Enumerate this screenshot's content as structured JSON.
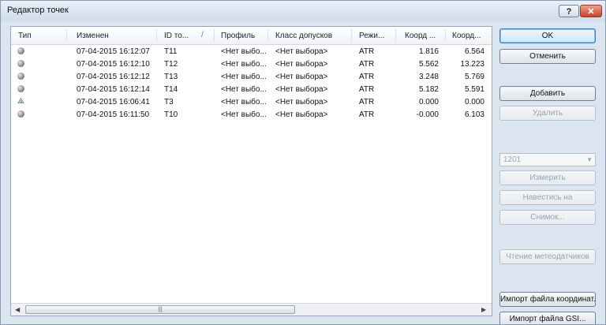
{
  "window": {
    "title": "Редактор точек",
    "help_label": "?",
    "close_label": "✕"
  },
  "columns": [
    "Тип",
    "Изменен",
    "ID то...",
    "Профиль",
    "Класс допусков",
    "Режи...",
    "Коорд ...",
    "Коорд..."
  ],
  "sort_indicator": "/",
  "rows": [
    {
      "type_icon": "gray-sphere-icon",
      "changed": "07-04-2015 16:12:07",
      "id": "T11",
      "profile": "<Нет выбо...",
      "tolerance": "<Нет выбора>",
      "mode": "ATR",
      "coord1": "1.816",
      "coord2": "6.564"
    },
    {
      "type_icon": "gray-sphere-icon",
      "changed": "07-04-2015 16:12:10",
      "id": "T12",
      "profile": "<Нет выбо...",
      "tolerance": "<Нет выбора>",
      "mode": "ATR",
      "coord1": "5.562",
      "coord2": "13.223"
    },
    {
      "type_icon": "gray-sphere-icon",
      "changed": "07-04-2015 16:12:12",
      "id": "T13",
      "profile": "<Нет выбо...",
      "tolerance": "<Нет выбора>",
      "mode": "ATR",
      "coord1": "3.248",
      "coord2": "5.769"
    },
    {
      "type_icon": "gray-sphere-icon",
      "changed": "07-04-2015 16:12:14",
      "id": "T14",
      "profile": "<Нет выбо...",
      "tolerance": "<Нет выбора>",
      "mode": "ATR",
      "coord1": "5.182",
      "coord2": "5.591"
    },
    {
      "type_icon": "instrument-tripod-icon",
      "changed": "07-04-2015 16:06:41",
      "id": "T3",
      "profile": "<Нет выбо...",
      "tolerance": "<Нет выбора>",
      "mode": "ATR",
      "coord1": "0.000",
      "coord2": "0.000"
    },
    {
      "type_icon": "gray-sphere-icon",
      "changed": "07-04-2015 16:11:50",
      "id": "T10",
      "profile": "<Нет выбо...",
      "tolerance": "<Нет выбора>",
      "mode": "ATR",
      "coord1": "-0.000",
      "coord2": "6.103"
    }
  ],
  "scrollbar": {
    "left_arrow": "◀",
    "right_arrow": "▶",
    "grip": "|||"
  },
  "buttons": {
    "ok": "OK",
    "cancel": "Отменить",
    "add": "Добавить",
    "delete": "Удалить",
    "measure": "Измерить",
    "aim": "Навестись на",
    "snapshot": "Снимок...",
    "meteo": "Чтение метеодатчиков",
    "import_coords": "Импорт файла координат...",
    "import_gsi": "Импорт файла GSI..."
  },
  "instrument_select": {
    "value": "1201",
    "arrow": "▼"
  }
}
